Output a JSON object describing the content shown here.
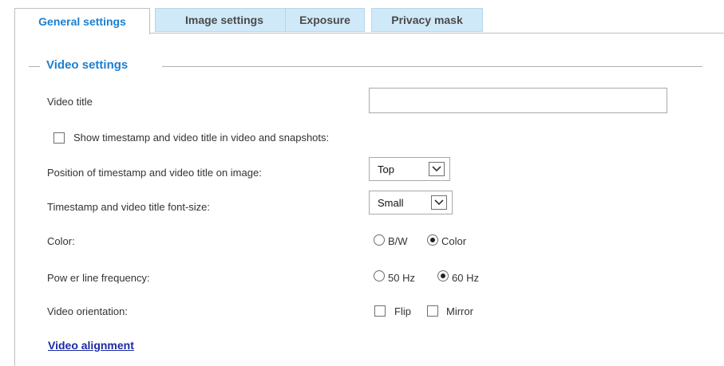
{
  "tabs": [
    {
      "label": "General settings",
      "active": true
    },
    {
      "label": "Image settings",
      "active": false
    },
    {
      "label": "Exposure",
      "active": false
    },
    {
      "label": "Privacy mask",
      "active": false
    }
  ],
  "section": {
    "legend": "Video settings"
  },
  "fields": {
    "video_title_label": "Video title",
    "video_title_value": "",
    "show_timestamp_label": "Show  timestamp and video title in video and snapshots:",
    "show_timestamp_checked": false,
    "position_label": "Position of timestamp and video title on image:",
    "position_value": "Top",
    "fontsize_label": "Timestamp and video title font-size:",
    "fontsize_value": "Small",
    "color_label": "Color:",
    "color_options": [
      "B/W",
      "Color"
    ],
    "color_selected": "Color",
    "power_label": "Pow er line frequency:",
    "power_options": [
      "50 Hz",
      "60 Hz"
    ],
    "power_selected": "60 Hz",
    "orientation_label": "Video orientation:",
    "orientation_options": [
      "Flip",
      "Mirror"
    ],
    "orientation_checked": []
  },
  "links": {
    "video_alignment": "Video alignment "
  },
  "colors": {
    "accent": "#1c7fd0",
    "tab_inactive_bg": "#cfe9f9",
    "link": "#1a2aa5"
  },
  "icons": {
    "select_arrow": "chevron-down-icon"
  }
}
